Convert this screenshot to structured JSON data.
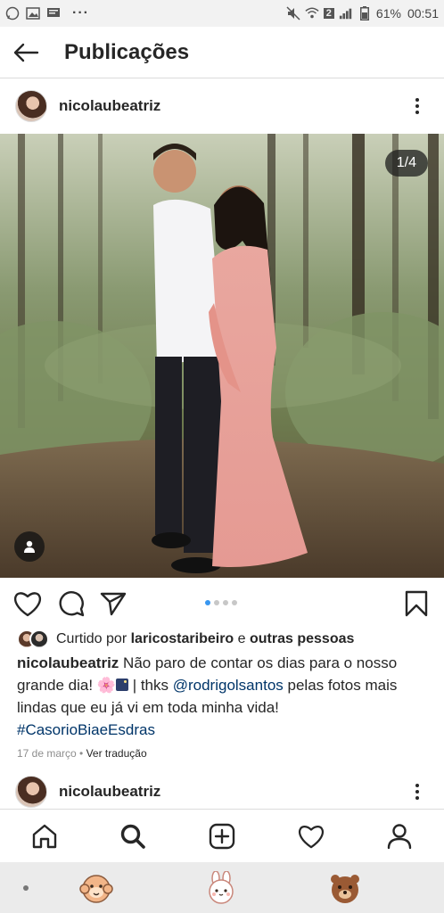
{
  "status_bar": {
    "battery": "61%",
    "time": "00:51",
    "sim_badge": "2",
    "overflow": "···"
  },
  "app_bar": {
    "title": "Publicações"
  },
  "post": {
    "username": "nicolaubeatriz",
    "image_counter": "1/4",
    "carousel": {
      "total": 4,
      "active": 1
    },
    "likes": {
      "prefix": "Curtido por ",
      "user": "laricostaribeiro",
      "connector": " e ",
      "others": "outras pessoas"
    },
    "caption": {
      "author": "nicolaubeatriz",
      "text1": " Não paro de contar os dias para o nosso grande dia! ",
      "flower_emoji": "🌸",
      "text2": " | thks ",
      "mention": "@rodrigolsantos",
      "text3": " pelas fotos mais lindas que eu já vi em toda minha vida!",
      "hashtag": "#CasorioBiaeEsdras"
    },
    "timestamp": "17 de março",
    "separator": " • ",
    "translate": "Ver tradução"
  },
  "next_post": {
    "username": "nicolaubeatriz"
  },
  "bottom_nav": [
    "home-icon",
    "search-icon",
    "add-icon",
    "activity-icon",
    "profile-icon"
  ],
  "colors": {
    "link": "#003569",
    "carousel_active": "#3897f0",
    "text": "#262626",
    "muted": "#8e8e8e"
  }
}
